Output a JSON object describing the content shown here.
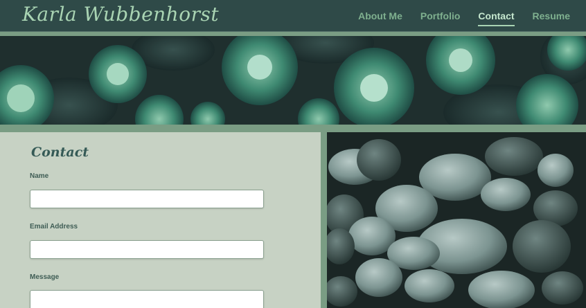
{
  "site": {
    "logo_text": "Karla Wubbenhorst"
  },
  "nav": {
    "items": [
      {
        "label": "About Me",
        "active": false
      },
      {
        "label": "Portfolio",
        "active": false
      },
      {
        "label": "Contact",
        "active": true
      },
      {
        "label": "Resume",
        "active": false
      }
    ]
  },
  "hero": {
    "image": "succulents-photo"
  },
  "contact": {
    "title": "Contact",
    "fields": {
      "name_label": "Name",
      "name_value": "",
      "email_label": "Email Address",
      "email_value": "",
      "message_label": "Message",
      "message_value": ""
    }
  },
  "side_image": {
    "image": "river-stones-photo"
  },
  "colors": {
    "header_bg": "#2f4a48",
    "accent": "#a9d4b3",
    "nav_link": "#7fb08f",
    "page_bg": "#7a9d84",
    "panel_bg": "#c7d2c4"
  }
}
